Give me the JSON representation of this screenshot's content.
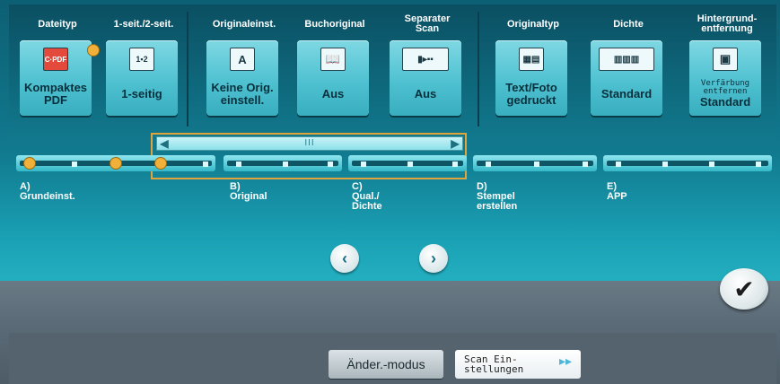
{
  "settings": [
    {
      "title": "Dateityp",
      "value": "Kompaktes\nPDF",
      "icon": "pdf-file-icon",
      "glyph": "C·PDF"
    },
    {
      "title": "1-seit./2-seit.",
      "value": "1-seitig",
      "icon": "one-sided-icon",
      "glyph": "1▪2"
    },
    {
      "title": "Originaleinst.",
      "value": "Keine Orig.\neinstell.",
      "icon": "original-setting-icon",
      "glyph": "A"
    },
    {
      "title": "Buchoriginal",
      "value": "Aus",
      "icon": "book-icon",
      "glyph": "📖"
    },
    {
      "title": "Separater\nScan",
      "value": "Aus",
      "icon": "separate-scan-icon",
      "glyph": "▮▸▪▪"
    },
    {
      "title": "Originaltyp",
      "value": "Text/Foto\ngedruckt",
      "icon": "text-photo-icon",
      "glyph": "▦▤"
    },
    {
      "title": "Dichte",
      "value": "Standard",
      "icon": "density-icon",
      "glyph": "▥▥▥"
    },
    {
      "title": "Hintergrund-\nentfernung",
      "value": "Standard",
      "value_prefix": "Verfärbung\nentfernen",
      "icon": "background-removal-icon",
      "glyph": "▣"
    }
  ],
  "tabs": [
    {
      "label": "A)\nGrundeinst."
    },
    {
      "label": "B)\nOriginal"
    },
    {
      "label": "C)\nQual./\nDichte"
    },
    {
      "label": "D)\nStempel\nerstellen"
    },
    {
      "label": "E)\nAPP"
    }
  ],
  "scroll": {
    "left": "◀",
    "right": "▶",
    "grip": "III"
  },
  "nav": {
    "prev": "‹",
    "next": "›"
  },
  "ok": {
    "label": "✔"
  },
  "footer": {
    "mode_button": "Änder.-modus",
    "scan_settings": "Scan Ein-\nstellungen",
    "scan_arrow": "▸▸"
  },
  "colors": {
    "accent": "#4fc1d1",
    "highlight": "#e0a43a",
    "marker": "#f0b03a"
  }
}
